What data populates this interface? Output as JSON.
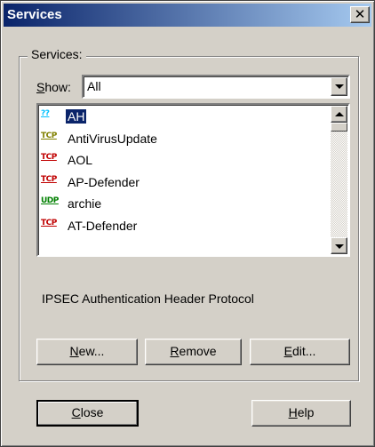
{
  "window": {
    "title": "Services"
  },
  "group": {
    "label": "Services:"
  },
  "show": {
    "label_prefix": "S",
    "label_rest": "how:",
    "selected": "All"
  },
  "list": {
    "items": [
      {
        "protocol": "??",
        "protocol_color": "#00c0ff",
        "label": "AH",
        "selected": true
      },
      {
        "protocol": "TCP",
        "protocol_color": "#808000",
        "label": "AntiVirusUpdate",
        "selected": false
      },
      {
        "protocol": "TCP",
        "protocol_color": "#c00000",
        "label": "AOL",
        "selected": false
      },
      {
        "protocol": "TCP",
        "protocol_color": "#c00000",
        "label": "AP-Defender",
        "selected": false
      },
      {
        "protocol": "UDP",
        "protocol_color": "#008000",
        "label": "archie",
        "selected": false
      },
      {
        "protocol": "TCP",
        "protocol_color": "#c00000",
        "label": "AT-Defender",
        "selected": false
      }
    ]
  },
  "description": "IPSEC Authentication Header Protocol",
  "buttons": {
    "new_u": "N",
    "new_rest": "ew...",
    "remove_u": "R",
    "remove_rest": "emove",
    "edit_u": "E",
    "edit_rest": "dit...",
    "close_u": "C",
    "close_rest": "lose",
    "help_u": "H",
    "help_rest": "elp"
  },
  "colors": {
    "titlebar_start": "#0a246a",
    "titlebar_end": "#a6caf0",
    "selection": "#0a246a",
    "face": "#d4d0c8"
  }
}
